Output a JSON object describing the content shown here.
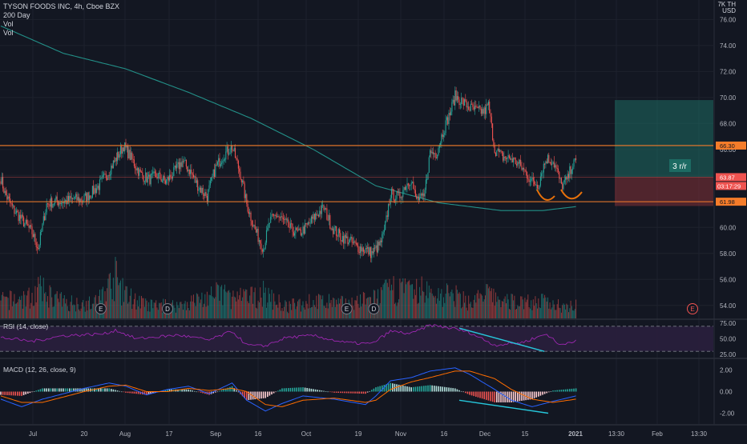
{
  "header": {
    "symbol_line": "TYSON FOODS INC, 4h, Cboe BZX",
    "indicator_1": "200 Day",
    "indicator_2": "Vol",
    "indicator_3": "Vol",
    "currency_top": "7K TH",
    "currency": "USD"
  },
  "colors": {
    "background": "#131722",
    "grid": "#1e222d",
    "up": "#26a69a",
    "down": "#ef5350",
    "sma": "#26a69a",
    "level_lines": "#f57c2a",
    "annotation": "#e8710a",
    "target_zone": "#1d6b63",
    "stop_zone": "#7a2e35",
    "rsi_line": "#9c27b0",
    "rsi_band": "#2a1f3d",
    "macd_line": "#2962ff",
    "signal_line": "#ff6d00",
    "divergence": "#26c6da"
  },
  "chart_data": [
    {
      "type": "candlestick",
      "title": "TYSON FOODS INC, 4h, Cboe BZX",
      "ylabel": "USD",
      "ylim": [
        53.0,
        77.5
      ],
      "y_ticks": [
        "76.00",
        "74.00",
        "72.00",
        "70.00",
        "68.00",
        "66.00",
        "64.00",
        "62.00",
        "60.00",
        "58.00",
        "56.00",
        "54.00"
      ],
      "x_ticks": [
        "Jul",
        "20",
        "Aug",
        "17",
        "Sep",
        "16",
        "Oct",
        "19",
        "Nov",
        "16",
        "Dec",
        "15",
        "2021",
        "13:30",
        "Feb",
        "13:30"
      ],
      "anchors": [
        [
          0,
          63.8
        ],
        [
          4,
          62.6
        ],
        [
          12,
          61.4
        ],
        [
          22,
          60.4
        ],
        [
          30,
          59.6
        ],
        [
          36,
          58.4
        ],
        [
          44,
          61.8
        ],
        [
          52,
          62.0
        ],
        [
          62,
          62.0
        ],
        [
          70,
          62.2
        ],
        [
          78,
          62.1
        ],
        [
          86,
          62.6
        ],
        [
          94,
          63.2
        ],
        [
          102,
          64.1
        ],
        [
          110,
          65.2
        ],
        [
          118,
          66.3
        ],
        [
          126,
          65.2
        ],
        [
          134,
          64.1
        ],
        [
          142,
          63.7
        ],
        [
          150,
          64.0
        ],
        [
          158,
          63.5
        ],
        [
          166,
          64.2
        ],
        [
          174,
          65.1
        ],
        [
          182,
          64.3
        ],
        [
          190,
          63.1
        ],
        [
          198,
          62.4
        ],
        [
          206,
          64.6
        ],
        [
          214,
          65.6
        ],
        [
          222,
          66.2
        ],
        [
          230,
          64.1
        ],
        [
          236,
          61.8
        ],
        [
          244,
          59.8
        ],
        [
          252,
          58.4
        ],
        [
          258,
          60.4
        ],
        [
          264,
          61.0
        ],
        [
          270,
          60.6
        ],
        [
          278,
          59.9
        ],
        [
          286,
          59.5
        ],
        [
          294,
          60.1
        ],
        [
          302,
          60.9
        ],
        [
          310,
          61.5
        ],
        [
          318,
          60.0
        ],
        [
          326,
          59.3
        ],
        [
          334,
          59.0
        ],
        [
          342,
          58.5
        ],
        [
          350,
          58.3
        ],
        [
          356,
          58.0
        ],
        [
          364,
          58.7
        ],
        [
          368,
          59.6
        ],
        [
          374,
          62.6
        ],
        [
          382,
          62.3
        ],
        [
          388,
          63.2
        ],
        [
          394,
          63.8
        ],
        [
          398,
          62.2
        ],
        [
          406,
          62.2
        ],
        [
          412,
          65.8
        ],
        [
          418,
          65.7
        ],
        [
          424,
          67.3
        ],
        [
          432,
          69.0
        ],
        [
          436,
          70.1
        ],
        [
          444,
          69.6
        ],
        [
          450,
          69.2
        ],
        [
          456,
          69.0
        ],
        [
          464,
          68.9
        ],
        [
          468,
          69.4
        ],
        [
          474,
          66.0
        ],
        [
          482,
          65.4
        ],
        [
          490,
          65.3
        ],
        [
          498,
          64.8
        ],
        [
          504,
          64.2
        ],
        [
          510,
          63.5
        ],
        [
          516,
          63.3
        ],
        [
          520,
          64.6
        ],
        [
          524,
          65.3
        ],
        [
          530,
          65.1
        ],
        [
          534,
          64.3
        ],
        [
          538,
          63.2
        ],
        [
          544,
          63.7
        ],
        [
          548,
          64.8
        ],
        [
          552,
          65.0
        ]
      ],
      "sma_anchors": [
        [
          0,
          75.5
        ],
        [
          60,
          73.4
        ],
        [
          120,
          72.2
        ],
        [
          180,
          70.4
        ],
        [
          240,
          68.4
        ],
        [
          300,
          66.0
        ],
        [
          360,
          63.2
        ],
        [
          420,
          61.9
        ],
        [
          480,
          61.3
        ],
        [
          520,
          61.3
        ],
        [
          552,
          61.6
        ]
      ],
      "volume_profile": [
        [
          0,
          0.3
        ],
        [
          12,
          0.32
        ],
        [
          30,
          0.36
        ],
        [
          36,
          0.5
        ],
        [
          60,
          0.28
        ],
        [
          90,
          0.25
        ],
        [
          104,
          0.55
        ],
        [
          110,
          0.7
        ],
        [
          118,
          0.42
        ],
        [
          140,
          0.22
        ],
        [
          170,
          0.22
        ],
        [
          206,
          0.4
        ],
        [
          214,
          0.45
        ],
        [
          222,
          0.34
        ],
        [
          240,
          0.36
        ],
        [
          252,
          0.42
        ],
        [
          274,
          0.2
        ],
        [
          300,
          0.3
        ],
        [
          330,
          0.25
        ],
        [
          356,
          0.32
        ],
        [
          374,
          0.48
        ],
        [
          386,
          0.5
        ],
        [
          396,
          0.42
        ],
        [
          406,
          0.52
        ],
        [
          412,
          0.4
        ],
        [
          430,
          0.42
        ],
        [
          450,
          0.28
        ],
        [
          468,
          0.42
        ],
        [
          474,
          0.36
        ],
        [
          486,
          0.28
        ],
        [
          500,
          0.3
        ],
        [
          520,
          0.28
        ],
        [
          540,
          0.22
        ],
        [
          552,
          0.26
        ]
      ],
      "levels": [
        {
          "label": "66.30",
          "value": 66.3
        },
        {
          "label": "63.87",
          "value": 63.87
        },
        {
          "label": "61.98",
          "value": 61.98
        }
      ],
      "countdown": "03:17:29",
      "position": {
        "label": "3 r/r",
        "target": 69.8,
        "entry": 63.87,
        "stop": 61.65
      },
      "event_markers": [
        {
          "label": "E",
          "bar": 96
        },
        {
          "label": "D",
          "bar": 160
        },
        {
          "label": "E",
          "bar": 332
        },
        {
          "label": "D",
          "bar": 358
        },
        {
          "label": "E",
          "bar": -1,
          "future": true
        }
      ]
    },
    {
      "type": "line",
      "title": "RSI (14, close)",
      "ylim": [
        20,
        80
      ],
      "y_ticks": [
        "75.00",
        "50.00",
        "25.00"
      ],
      "band": [
        30,
        70
      ],
      "anchors": [
        [
          0,
          52
        ],
        [
          30,
          46
        ],
        [
          60,
          55
        ],
        [
          100,
          58
        ],
        [
          110,
          64
        ],
        [
          130,
          50
        ],
        [
          170,
          56
        ],
        [
          200,
          48
        ],
        [
          222,
          62
        ],
        [
          236,
          40
        ],
        [
          252,
          38
        ],
        [
          274,
          52
        ],
        [
          300,
          55
        ],
        [
          330,
          44
        ],
        [
          356,
          42
        ],
        [
          374,
          62
        ],
        [
          394,
          58
        ],
        [
          412,
          72
        ],
        [
          436,
          66
        ],
        [
          450,
          60
        ],
        [
          474,
          40
        ],
        [
          500,
          44
        ],
        [
          524,
          58
        ],
        [
          536,
          40
        ],
        [
          552,
          48
        ]
      ],
      "divergence_line": [
        [
          340,
          67
        ],
        [
          410,
          30
        ]
      ]
    },
    {
      "type": "line",
      "title": "MACD (12, 26, close, 9)",
      "ylim": [
        -3,
        3
      ],
      "y_ticks": [
        "2.00",
        "0.00",
        "-2.00"
      ],
      "macd_anchors": [
        [
          0,
          -0.7
        ],
        [
          20,
          -1.4
        ],
        [
          40,
          -0.7
        ],
        [
          60,
          -0.2
        ],
        [
          80,
          0.3
        ],
        [
          104,
          0.8
        ],
        [
          120,
          0.5
        ],
        [
          140,
          -0.3
        ],
        [
          160,
          0.2
        ],
        [
          180,
          0.5
        ],
        [
          200,
          -0.2
        ],
        [
          222,
          0.8
        ],
        [
          236,
          -0.8
        ],
        [
          254,
          -1.8
        ],
        [
          270,
          -1.1
        ],
        [
          290,
          -0.4
        ],
        [
          320,
          -0.7
        ],
        [
          350,
          -1.2
        ],
        [
          360,
          -0.4
        ],
        [
          374,
          1.0
        ],
        [
          394,
          1.3
        ],
        [
          412,
          1.9
        ],
        [
          436,
          2.2
        ],
        [
          450,
          1.6
        ],
        [
          474,
          0.2
        ],
        [
          490,
          -0.8
        ],
        [
          510,
          -1.4
        ],
        [
          530,
          -0.9
        ],
        [
          552,
          -0.4
        ]
      ],
      "signal_anchors": [
        [
          0,
          -0.4
        ],
        [
          20,
          -1.0
        ],
        [
          40,
          -1.0
        ],
        [
          60,
          -0.5
        ],
        [
          80,
          0.0
        ],
        [
          104,
          0.5
        ],
        [
          120,
          0.6
        ],
        [
          140,
          0.0
        ],
        [
          160,
          0.0
        ],
        [
          180,
          0.3
        ],
        [
          200,
          0.1
        ],
        [
          222,
          0.3
        ],
        [
          236,
          0.0
        ],
        [
          254,
          -1.2
        ],
        [
          270,
          -1.4
        ],
        [
          290,
          -0.8
        ],
        [
          320,
          -0.6
        ],
        [
          350,
          -1.0
        ],
        [
          360,
          -0.8
        ],
        [
          374,
          0.2
        ],
        [
          394,
          0.9
        ],
        [
          412,
          1.3
        ],
        [
          436,
          1.9
        ],
        [
          450,
          1.9
        ],
        [
          474,
          1.2
        ],
        [
          490,
          0.2
        ],
        [
          510,
          -0.7
        ],
        [
          530,
          -1.0
        ],
        [
          552,
          -0.7
        ]
      ],
      "divergence_line": [
        [
          340,
          -0.8
        ],
        [
          410,
          -2.0
        ]
      ]
    }
  ]
}
